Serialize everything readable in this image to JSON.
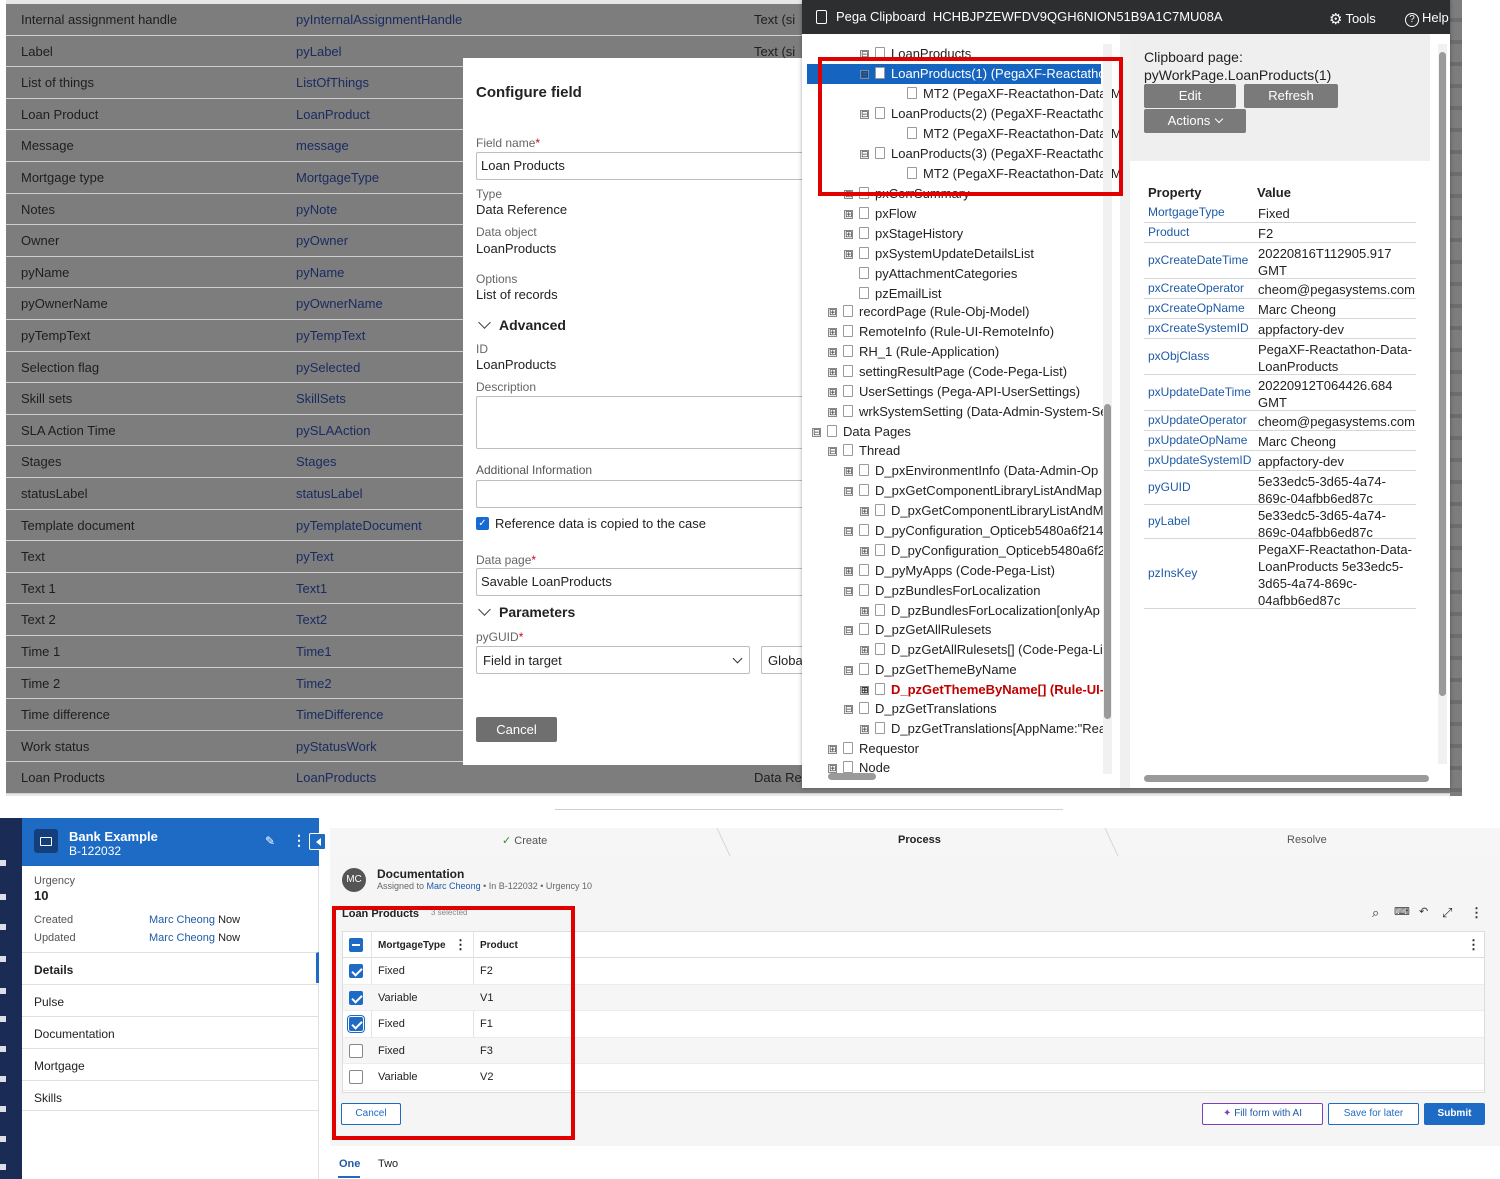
{
  "designer": {
    "rows": [
      {
        "label": "Internal assignment handle",
        "id": "pyInternalAssignmentHandle",
        "type": "Text (si"
      },
      {
        "label": "Label",
        "id": "pyLabel",
        "type": "Text (si"
      },
      {
        "label": "List of things",
        "id": "ListOfThings",
        "type": ""
      },
      {
        "label": "Loan Product",
        "id": "LoanProduct",
        "type": ""
      },
      {
        "label": "Message",
        "id": "message",
        "type": ""
      },
      {
        "label": "Mortgage type",
        "id": "MortgageType",
        "type": ""
      },
      {
        "label": "Notes",
        "id": "pyNote",
        "type": ""
      },
      {
        "label": "Owner",
        "id": "pyOwner",
        "type": ""
      },
      {
        "label": "pyName",
        "id": "pyName",
        "type": ""
      },
      {
        "label": "pyOwnerName",
        "id": "pyOwnerName",
        "type": ""
      },
      {
        "label": "pyTempText",
        "id": "pyTempText",
        "type": ""
      },
      {
        "label": "Selection flag",
        "id": "pySelected",
        "type": ""
      },
      {
        "label": "Skill sets",
        "id": "SkillSets",
        "type": ""
      },
      {
        "label": "SLA Action Time",
        "id": "pySLAAction",
        "type": ""
      },
      {
        "label": "Stages",
        "id": "Stages",
        "type": ""
      },
      {
        "label": "statusLabel",
        "id": "statusLabel",
        "type": ""
      },
      {
        "label": "Template document",
        "id": "pyTemplateDocument",
        "type": ""
      },
      {
        "label": "Text",
        "id": "pyText",
        "type": ""
      },
      {
        "label": "Text 1",
        "id": "Text1",
        "type": ""
      },
      {
        "label": "Text 2",
        "id": "Text2",
        "type": ""
      },
      {
        "label": "Time 1",
        "id": "Time1",
        "type": ""
      },
      {
        "label": "Time 2",
        "id": "Time2",
        "type": ""
      },
      {
        "label": "Time difference",
        "id": "TimeDifference",
        "type": ""
      },
      {
        "label": "Work status",
        "id": "pyStatusWork",
        "type": ""
      },
      {
        "label": "Loan Products",
        "id": "LoanProducts",
        "type": "Data Re"
      }
    ]
  },
  "modal": {
    "title": "Configure field",
    "field_name_label": "Field name",
    "field_name_value": "Loan Products",
    "type_label": "Type",
    "type_value": "Data Reference",
    "data_object_label": "Data object",
    "data_object_value": "LoanProducts",
    "options_label": "Options",
    "options_value": "List of records",
    "advanced_label": "Advanced",
    "id_label": "ID",
    "id_value": "LoanProducts",
    "description_label": "Description",
    "additional_label": "Additional Information",
    "reference_copied_label": "Reference data is copied to the case",
    "data_page_label": "Data page",
    "data_page_value": "Savable LoanProducts",
    "parameters_label": "Parameters",
    "pyguid_label": "pyGUID",
    "pyguid_value": "Field in target",
    "global_value": "Globa",
    "cancel_label": "Cancel"
  },
  "clipboard": {
    "title": "Pega Clipboard",
    "requestor_id": "HCHBJPZEWFDV9QGH6NION51B9A1C7MU08A",
    "tools_label": "Tools",
    "help_label": "Help",
    "tree": [
      {
        "text": "LoanProducts",
        "toggle": "⊟"
      },
      {
        "text": "LoanProducts(1) (PegaXF-Reactathon",
        "toggle": "⊟"
      },
      {
        "text": "MT2 (PegaXF-Reactathon-Data-Mo",
        "toggle": ""
      },
      {
        "text": "LoanProducts(2) (PegaXF-Reactathon",
        "toggle": "⊟"
      },
      {
        "text": "MT2 (PegaXF-Reactathon-Data-Mo",
        "toggle": ""
      },
      {
        "text": "LoanProducts(3) (PegaXF-Reactathon",
        "toggle": "⊟"
      },
      {
        "text": "MT2 (PegaXF-Reactathon-Data-Mo",
        "toggle": ""
      },
      {
        "text": "pxCorrSummary",
        "toggle": "⊞"
      },
      {
        "text": "pxFlow",
        "toggle": "⊞"
      },
      {
        "text": "pxStageHistory",
        "toggle": "⊞"
      },
      {
        "text": "pxSystemUpdateDetailsList",
        "toggle": "⊞"
      },
      {
        "text": "pyAttachmentCategories",
        "toggle": ""
      },
      {
        "text": "pzEmailList",
        "toggle": ""
      },
      {
        "text": "recordPage (Rule-Obj-Model)",
        "toggle": "⊞"
      },
      {
        "text": "RemoteInfo (Rule-UI-RemoteInfo)",
        "toggle": "⊞"
      },
      {
        "text": "RH_1 (Rule-Application)",
        "toggle": "⊞"
      },
      {
        "text": "settingResultPage (Code-Pega-List)",
        "toggle": "⊞"
      },
      {
        "text": "UserSettings (Pega-API-UserSettings)",
        "toggle": "⊞"
      },
      {
        "text": "wrkSystemSetting (Data-Admin-System-Se",
        "toggle": "⊞"
      },
      {
        "text": "Data Pages",
        "toggle": "⊟"
      },
      {
        "text": "Thread",
        "toggle": "⊟"
      },
      {
        "text": "D_pxEnvironmentInfo (Data-Admin-Op",
        "toggle": "⊞"
      },
      {
        "text": "D_pxGetComponentLibraryListAndMap",
        "toggle": "⊟"
      },
      {
        "text": "D_pxGetComponentLibraryListAndM",
        "toggle": "⊞"
      },
      {
        "text": "D_pyConfiguration_Opticeb5480a6f214",
        "toggle": "⊟"
      },
      {
        "text": "D_pyConfiguration_Opticeb5480a6f2",
        "toggle": "⊞"
      },
      {
        "text": "D_pyMyApps (Code-Pega-List)",
        "toggle": "⊞"
      },
      {
        "text": "D_pzBundlesForLocalization",
        "toggle": "⊟"
      },
      {
        "text": "D_pzBundlesForLocalization[onlyAp",
        "toggle": "⊞"
      },
      {
        "text": "D_pzGetAllRulesets",
        "toggle": "⊟"
      },
      {
        "text": "D_pzGetAllRulesets[] (Code-Pega-Lis",
        "toggle": "⊞"
      },
      {
        "text": "D_pzGetThemeByName",
        "toggle": "⊟"
      },
      {
        "text": "D_pzGetThemeByName[] (Rule-UI-",
        "toggle": "⊞"
      },
      {
        "text": "D_pzGetTranslations",
        "toggle": "⊟"
      },
      {
        "text": "D_pzGetTranslations[AppName:\"Rea",
        "toggle": "⊞"
      },
      {
        "text": "Requestor",
        "toggle": "⊞"
      },
      {
        "text": "Node",
        "toggle": "⊞"
      }
    ],
    "page_heading": "Clipboard page:",
    "page_name": "pyWorkPage.LoanProducts(1)",
    "edit_label": "Edit",
    "refresh_label": "Refresh",
    "actions_label": "Actions",
    "property_header": "Property",
    "value_header": "Value",
    "properties": [
      {
        "key": "MortgageType",
        "value": "Fixed"
      },
      {
        "key": "Product",
        "value": "F2"
      },
      {
        "key": "pxCreateDateTime",
        "value": "20220816T112905.917 GMT"
      },
      {
        "key": "pxCreateOperator",
        "value": "cheom@pegasystems.com"
      },
      {
        "key": "pxCreateOpName",
        "value": "Marc Cheong"
      },
      {
        "key": "pxCreateSystemID",
        "value": "appfactory-dev"
      },
      {
        "key": "pxObjClass",
        "value": "PegaXF-Reactathon-Data-LoanProducts"
      },
      {
        "key": "pxUpdateDateTime",
        "value": "20220912T064426.684 GMT"
      },
      {
        "key": "pxUpdateOperator",
        "value": "cheom@pegasystems.com"
      },
      {
        "key": "pxUpdateOpName",
        "value": "Marc Cheong"
      },
      {
        "key": "pxUpdateSystemID",
        "value": "appfactory-dev"
      },
      {
        "key": "pyGUID",
        "value": "5e33edc5-3d65-4a74-869c-04afbb6ed87c"
      },
      {
        "key": "pyLabel",
        "value": "5e33edc5-3d65-4a74-869c-04afbb6ed87c"
      },
      {
        "key": "pzInsKey",
        "value": "PegaXF-Reactathon-Data-LoanProducts 5e33edc5-3d65-4a74-869c-04afbb6ed87c"
      }
    ]
  },
  "case": {
    "name": "Bank Example",
    "id": "B-122032",
    "urgency_label": "Urgency",
    "urgency_value": "10",
    "created_label": "Created",
    "created_by": "Marc Cheong",
    "created_when": "Now",
    "updated_label": "Updated",
    "updated_by": "Marc Cheong",
    "updated_when": "Now",
    "nav": [
      "Details",
      "Pulse",
      "Documentation",
      "Mortgage",
      "Skills"
    ],
    "stages": [
      "Create",
      "Process",
      "Resolve"
    ],
    "avatar": "MC",
    "assignment_title": "Documentation",
    "assigned_prefix": "Assigned to",
    "assigned_to": "Marc Cheong",
    "assigned_suffix": "• In B-122032 • Urgency 10",
    "table_title": "Loan Products",
    "table_selected": "3 selected",
    "col_mortgage": "MortgageType",
    "col_product": "Product",
    "rows": [
      {
        "mortgage": "Fixed",
        "product": "F2",
        "checked": true
      },
      {
        "mortgage": "Variable",
        "product": "V1",
        "checked": true
      },
      {
        "mortgage": "Fixed",
        "product": "F1",
        "checked": true
      },
      {
        "mortgage": "Fixed",
        "product": "F3",
        "checked": false
      },
      {
        "mortgage": "Variable",
        "product": "V2",
        "checked": false
      }
    ],
    "cancel_label": "Cancel",
    "fill_ai_label": "Fill form with AI",
    "save_later_label": "Save for later",
    "submit_label": "Submit",
    "tabs": [
      "One",
      "Two"
    ]
  },
  "colors": {
    "accent": "#1e6bc6",
    "highlight_box": "#e00000",
    "clipboard_header": "#2d2e30",
    "nav_dark": "#1a2c56"
  }
}
